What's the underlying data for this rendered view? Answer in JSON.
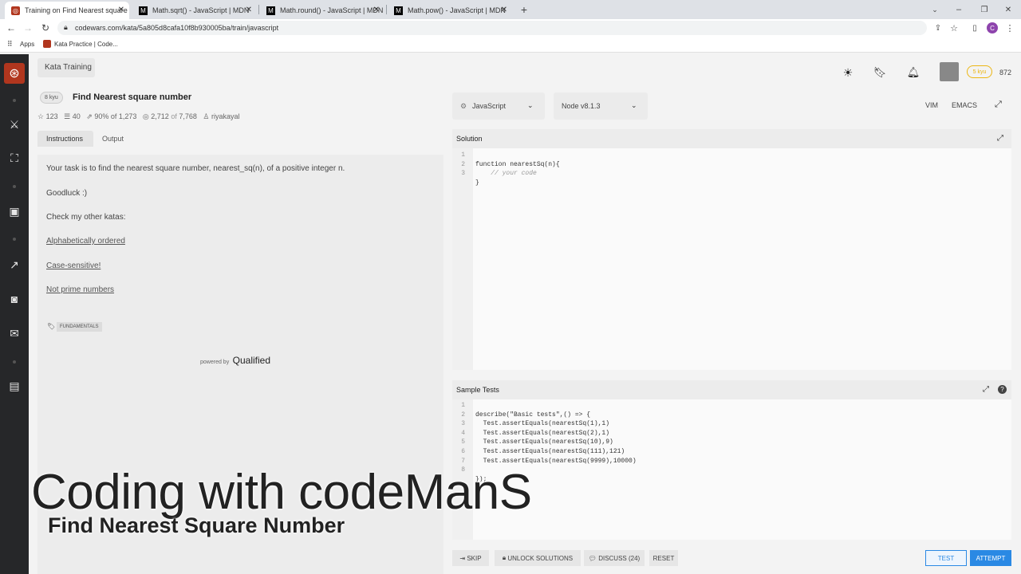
{
  "browser": {
    "tabs": [
      {
        "title": "Training on Find Nearest square",
        "icon": "codewars-favicon"
      },
      {
        "title": "Math.sqrt() - JavaScript | MDN",
        "icon": "mdn-favicon"
      },
      {
        "title": "Math.round() - JavaScript | MDN",
        "icon": "mdn-favicon"
      },
      {
        "title": "Math.pow() - JavaScript | MDN",
        "icon": "mdn-favicon"
      }
    ],
    "url": "codewars.com/kata/5a805d8cafa10f8b930005ba/train/javascript",
    "bookmarks": [
      "Apps",
      "Kata Practice | Code..."
    ],
    "profile_initial": "C"
  },
  "header": {
    "breadcrumb": "Kata Training",
    "rank_badge": "5 kyu",
    "honor": "872"
  },
  "kata": {
    "level": "8 kyu",
    "title": "Find Nearest square number",
    "stars": "123",
    "collections": "40",
    "satisfaction": "90% of 1,273",
    "completed": "2,712",
    "completed_of": "of",
    "total": "7,768",
    "author": "riyakayal"
  },
  "tabs": {
    "instructions": "Instructions",
    "output": "Output"
  },
  "instructions": {
    "p1": "Your task is to find the nearest square number, nearest_sq(n), of a positive integer n.",
    "p2": "Goodluck :)",
    "p3": "Check my other katas:",
    "links": [
      "Alphabetically ordered",
      "Case-sensitive!",
      "Not prime numbers"
    ],
    "tag": "FUNDAMENTALS",
    "powered_by": "powered by",
    "powered_brand": "Qualified"
  },
  "editor": {
    "language": "JavaScript",
    "runtime": "Node v8.1.3",
    "mode_vim": "VIM",
    "mode_emacs": "EMACS",
    "solution_label": "Solution",
    "solution_lines": [
      "function nearestSq(n){",
      "    // your code",
      "}"
    ],
    "tests_label": "Sample Tests",
    "tests_lines": [
      "describe(\"Basic tests\",() => {",
      "  Test.assertEquals(nearestSq(1),1)",
      "  Test.assertEquals(nearestSq(2),1)",
      "  Test.assertEquals(nearestSq(10),9)",
      "  Test.assertEquals(nearestSq(111),121)",
      "  Test.assertEquals(nearestSq(9999),10000)",
      "",
      "});"
    ]
  },
  "actions": {
    "skip": "SKIP",
    "unlock": "UNLOCK SOLUTIONS",
    "discuss": "DISCUSS (24)",
    "reset": "RESET",
    "test": "TEST",
    "attempt": "ATTEMPT"
  },
  "overlay": {
    "title": "Coding with codeManS",
    "subtitle": "Find Nearest Square Number"
  },
  "colors": {
    "accent": "#2a89e4",
    "brand_red": "#b1361e",
    "rank": "#ecb613"
  }
}
